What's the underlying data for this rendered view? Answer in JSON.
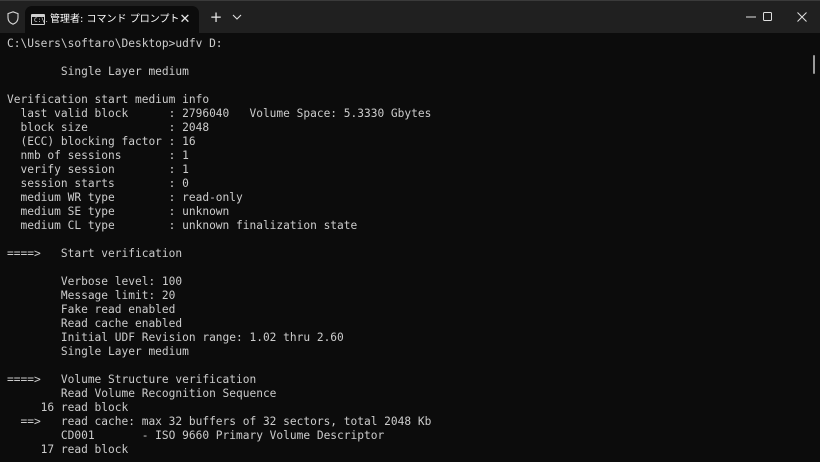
{
  "titlebar": {
    "tab_title": "管理者: コマンド プロンプト",
    "tab_icon_text": "C:\\.",
    "tab_close_glyph": "✕",
    "new_tab_glyph": "+"
  },
  "icons": {
    "shield": "shield-icon",
    "tab_icon": "cmd-icon",
    "close": "close-icon",
    "new_tab": "plus-icon",
    "dropdown": "chevron-down-icon",
    "minimize": "minimize-icon",
    "maximize": "maximize-icon",
    "window_close": "close-icon"
  },
  "colors": {
    "terminal_bg": "#0c0c0c",
    "terminal_text": "#cccccc",
    "titlebar_bg": "#202020"
  },
  "terminal": {
    "lines": [
      "C:\\Users\\softaro\\Desktop>udfv D:",
      "",
      "        Single Layer medium",
      "",
      "Verification start medium info",
      "  last valid block      : 2796040   Volume Space: 5.3330 Gbytes",
      "  block size            : 2048",
      "  (ECC) blocking factor : 16",
      "  nmb of sessions       : 1",
      "  verify session        : 1",
      "  session starts        : 0",
      "  medium WR type        : read-only",
      "  medium SE type        : unknown",
      "  medium CL type        : unknown finalization state",
      "",
      "====>   Start verification",
      "",
      "        Verbose level: 100",
      "        Message limit: 20",
      "        Fake read enabled",
      "        Read cache enabled",
      "        Initial UDF Revision range: 1.02 thru 2.60",
      "        Single Layer medium",
      "",
      "====>   Volume Structure verification",
      "        Read Volume Recognition Sequence",
      "     16 read block",
      "  ==>   read cache: max 32 buffers of 32 sectors, total 2048 Kb",
      "        CD001       - ISO 9660 Primary Volume Descriptor",
      "     17 read block"
    ]
  }
}
